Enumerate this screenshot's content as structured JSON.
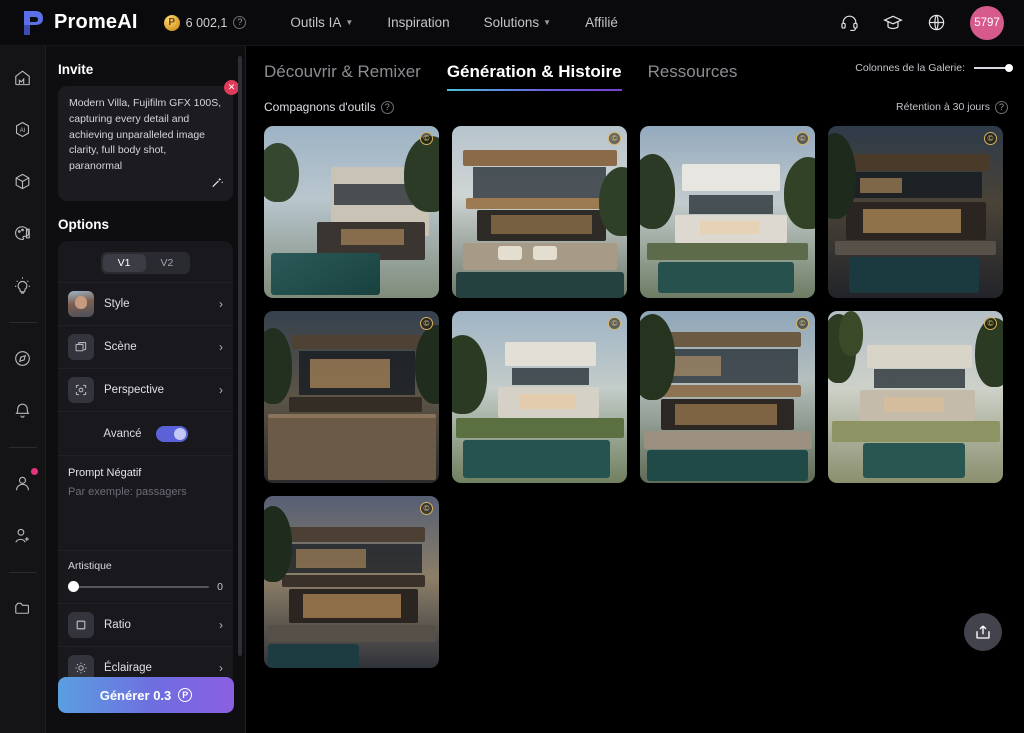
{
  "topbar": {
    "brand": "PromeAI",
    "logo_icon": "promeai-logo-icon",
    "credits": {
      "value": "6 002,1",
      "coin_icon": "coin-icon",
      "help_icon": "help-icon"
    },
    "nav": [
      {
        "label": "Outils IA",
        "icon": "chevron-down-icon",
        "has_caret": true
      },
      {
        "label": "Inspiration",
        "has_caret": false
      },
      {
        "label": "Solutions",
        "icon": "chevron-down-icon",
        "has_caret": true
      },
      {
        "label": "Affilié",
        "has_caret": false
      }
    ],
    "actions": [
      {
        "name": "support-headset-icon"
      },
      {
        "name": "graduation-cap-icon"
      },
      {
        "name": "globe-language-icon"
      }
    ],
    "avatar": {
      "label": "5797",
      "color": "#d65a8c"
    }
  },
  "rail": [
    {
      "name": "home-icon"
    },
    {
      "name": "ai-icon"
    },
    {
      "name": "cube-3d-icon"
    },
    {
      "name": "palette-icon"
    },
    {
      "name": "lightbulb-icon"
    },
    {
      "name": "compass-icon"
    },
    {
      "name": "bell-icon"
    },
    {
      "name": "user-icon",
      "badge": true
    },
    {
      "name": "add-user-icon"
    },
    {
      "name": "folder-icon"
    }
  ],
  "panel": {
    "prompt_section_title": "Invite",
    "prompt_value": "Modern Villa, Fujifilm GFX 100S, capturing every detail and achieving unparalleled image clarity, full body shot, paranormal",
    "clear_icon": "close-icon",
    "enhance_icon": "magic-wand-icon",
    "options_title": "Options",
    "version_tabs": [
      {
        "label": "V1",
        "active": true
      },
      {
        "label": "V2",
        "active": false
      }
    ],
    "option_rows": [
      {
        "label": "Style",
        "icon": "style-portrait-thumbnail",
        "thumb": "photo"
      },
      {
        "label": "Scène",
        "icon": "scene-layers-icon",
        "thumb": "icon"
      },
      {
        "label": "Perspective",
        "icon": "perspective-focus-icon",
        "thumb": "icon"
      }
    ],
    "advanced": {
      "label": "Avancé",
      "enabled": true,
      "color": "#5b62d8"
    },
    "negative_prompt": {
      "title": "Prompt Négatif",
      "placeholder": "Par exemple: passagers",
      "value": ""
    },
    "artistic": {
      "label": "Artistique",
      "value": "0"
    },
    "bottom_rows": [
      {
        "label": "Ratio",
        "icon": "ratio-square-icon"
      },
      {
        "label": "Éclairage",
        "icon": "lighting-sun-icon"
      }
    ],
    "generate": {
      "label": "Générer 0.3",
      "coin_icon": "credit-coin-icon"
    }
  },
  "main": {
    "tabs": [
      {
        "label": "Découvrir & Remixer",
        "active": false
      },
      {
        "label": "Génération & Histoire",
        "active": true
      },
      {
        "label": "Ressources",
        "active": false
      }
    ],
    "gallery_columns": {
      "label": "Colonnes de la Galerie:",
      "value": 4
    },
    "subtitle": {
      "label": "Compagnons d'outils",
      "help_icon": "help-icon"
    },
    "retention": {
      "label": "Rétention à 30 jours",
      "help_icon": "help-icon"
    },
    "cards": [
      {
        "name": "villa-pool-daylight",
        "variant": "v1",
        "badge": "copyright-badge"
      },
      {
        "name": "villa-wood-canopy-terrace",
        "variant": "v2",
        "badge": "copyright-badge"
      },
      {
        "name": "villa-white-box-pool",
        "variant": "v3",
        "badge": "copyright-badge"
      },
      {
        "name": "villa-evening-lit-pool",
        "variant": "v4",
        "badge": "copyright-badge"
      },
      {
        "name": "villa-dusk-deck",
        "variant": "v5",
        "badge": "copyright-badge"
      },
      {
        "name": "villa-modern-lawn-pool",
        "variant": "v6",
        "badge": "copyright-badge"
      },
      {
        "name": "villa-corner-glass-pool",
        "variant": "v7",
        "badge": "copyright-badge"
      },
      {
        "name": "villa-palm-courtyard",
        "variant": "v8",
        "badge": "copyright-badge"
      },
      {
        "name": "villa-twilight-overhang",
        "variant": "v9",
        "badge": "copyright-badge"
      }
    ],
    "fab": {
      "name": "share-export-icon"
    }
  }
}
